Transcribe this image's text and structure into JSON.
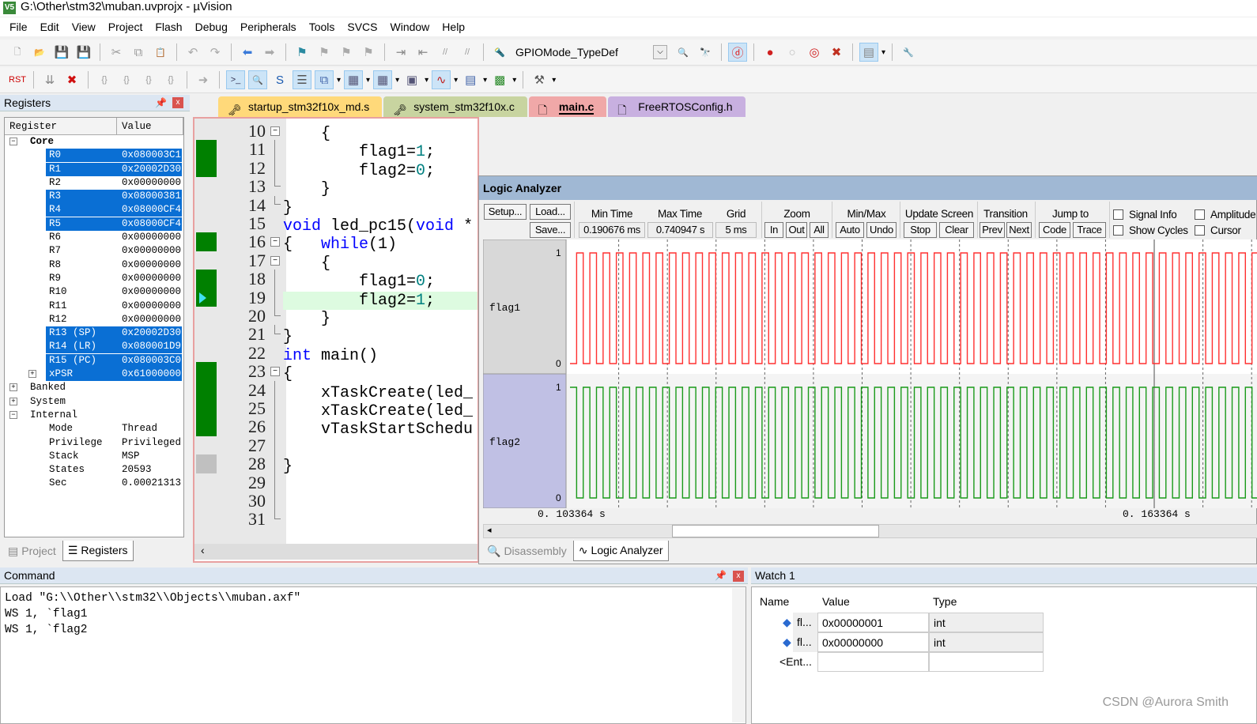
{
  "window": {
    "title": "G:\\Other\\stm32\\muban.uvprojx - µVision",
    "app_icon": "V5"
  },
  "menu": [
    "File",
    "Edit",
    "View",
    "Project",
    "Flash",
    "Debug",
    "Peripherals",
    "Tools",
    "SVCS",
    "Window",
    "Help"
  ],
  "toolbar1": {
    "icons_a": [
      "new-file-icon",
      "open-folder-icon",
      "save-icon",
      "save-all-icon",
      "|",
      "cut-icon",
      "copy-icon",
      "paste-icon",
      "|",
      "undo-icon",
      "redo-icon",
      "|",
      "nav-back-icon",
      "nav-forward-icon",
      "|",
      "bookmark-icon",
      "prev-bookmark-icon",
      "next-bookmark-icon",
      "clear-bookmarks-icon",
      "|",
      "indent-icon",
      "unindent-icon",
      "comment-icon",
      "uncomment-icon",
      "|",
      "find-in-files-icon"
    ],
    "combo_value": "GPIOMode_TypeDef",
    "icons_b": [
      "find-icon",
      "incremental-find-icon",
      "|",
      "debug-session-icon",
      "|",
      "breakpoint-icon",
      "disable-breakpoint-icon",
      "disable-all-breakpoints-icon",
      "kill-all-breakpoints-icon",
      "|",
      "window-layout-icon",
      "|",
      "configure-icon"
    ]
  },
  "toolbar2": {
    "icons": [
      "reset-icon",
      "|",
      "run-icon",
      "stop-icon",
      "|",
      "step-icon",
      "step-over-icon",
      "step-out-icon",
      "run-to-cursor-icon",
      "|",
      "show-next-statement-icon",
      "|",
      "command-window-icon",
      "disassembly-window-icon",
      "symbols-window-icon",
      "registers-window-icon",
      "call-stack-icon",
      "watch-window-icon",
      "memory-window-icon",
      "serial-window-icon",
      "analysis-window-icon",
      "trace-window-icon",
      "system-viewer-icon",
      "|",
      "toolbox-icon"
    ],
    "active": [
      "command-window-icon",
      "disassembly-window-icon",
      "registers-window-icon",
      "call-stack-icon",
      "watch-window-icon",
      "memory-window-icon",
      "analysis-window-icon",
      "debug-session-icon",
      "window-layout-icon"
    ]
  },
  "registers": {
    "title": "Registers",
    "col_register": "Register",
    "col_value": "Value",
    "rows": [
      {
        "name": "Core",
        "value": "",
        "level": 0,
        "expander": "-",
        "bold": true
      },
      {
        "name": "R0",
        "value": "0x080003C1",
        "level": 1,
        "sel": true
      },
      {
        "name": "R1",
        "value": "0x20002D30",
        "level": 1,
        "sel": true
      },
      {
        "name": "R2",
        "value": "0x00000000",
        "level": 1
      },
      {
        "name": "R3",
        "value": "0x08000381",
        "level": 1,
        "sel": true
      },
      {
        "name": "R4",
        "value": "0x08000CF4",
        "level": 1,
        "sel": true
      },
      {
        "name": "R5",
        "value": "0x08000CF4",
        "level": 1,
        "sel": true
      },
      {
        "name": "R6",
        "value": "0x00000000",
        "level": 1
      },
      {
        "name": "R7",
        "value": "0x00000000",
        "level": 1
      },
      {
        "name": "R8",
        "value": "0x00000000",
        "level": 1
      },
      {
        "name": "R9",
        "value": "0x00000000",
        "level": 1
      },
      {
        "name": "R10",
        "value": "0x00000000",
        "level": 1
      },
      {
        "name": "R11",
        "value": "0x00000000",
        "level": 1
      },
      {
        "name": "R12",
        "value": "0x00000000",
        "level": 1
      },
      {
        "name": "R13 (SP)",
        "value": "0x20002D30",
        "level": 1,
        "sel": true
      },
      {
        "name": "R14 (LR)",
        "value": "0x080001D9",
        "level": 1,
        "sel": true
      },
      {
        "name": "R15 (PC)",
        "value": "0x080003C0",
        "level": 1,
        "sel": true
      },
      {
        "name": "xPSR",
        "value": "0x61000000",
        "level": 1,
        "sel": true,
        "expander": "+"
      },
      {
        "name": "Banked",
        "value": "",
        "level": 0,
        "expander": "+"
      },
      {
        "name": "System",
        "value": "",
        "level": 0,
        "expander": "+"
      },
      {
        "name": "Internal",
        "value": "",
        "level": 0,
        "expander": "-"
      },
      {
        "name": "Mode",
        "value": "Thread",
        "level": 1
      },
      {
        "name": "Privilege",
        "value": "Privileged",
        "level": 1
      },
      {
        "name": "Stack",
        "value": "MSP",
        "level": 1
      },
      {
        "name": "States",
        "value": "20593",
        "level": 1
      },
      {
        "name": "Sec",
        "value": "0.00021313",
        "level": 1
      }
    ],
    "tabs": [
      {
        "label": "Project",
        "active": false
      },
      {
        "label": "Registers",
        "active": true
      }
    ]
  },
  "editor": {
    "tabs": [
      {
        "label": "startup_stm32f10x_md.s",
        "color": "#ffd97a",
        "icon": "key-file-icon"
      },
      {
        "label": "system_stm32f10x.c",
        "color": "#c8d4a0",
        "icon": "key-file-icon"
      },
      {
        "label": "main.c",
        "color": "#f0a8a8",
        "icon": "file-icon",
        "active": true
      },
      {
        "label": "FreeRTOSConfig.h",
        "color": "#c8b0e0",
        "icon": "file-icon"
      }
    ],
    "lines": [
      {
        "n": "10",
        "fold": "box",
        "code": [
          [
            "",
            "    {"
          ]
        ]
      },
      {
        "n": "11",
        "fold": "line",
        "mark": true,
        "code": [
          [
            "",
            "        flag1="
          ],
          [
            "num",
            "1"
          ],
          [
            "",
            ";"
          ]
        ]
      },
      {
        "n": "12",
        "fold": "line",
        "mark": true,
        "code": [
          [
            "",
            "        flag2="
          ],
          [
            "num",
            "0"
          ],
          [
            "",
            ";"
          ]
        ]
      },
      {
        "n": "13",
        "fold": "tee",
        "code": [
          [
            "",
            "    }"
          ]
        ]
      },
      {
        "n": "14",
        "fold": "end",
        "code": [
          [
            "",
            "}"
          ]
        ]
      },
      {
        "n": "15",
        "fold": "",
        "code": [
          [
            "kw",
            "void"
          ],
          [
            "",
            " led_pc15("
          ],
          [
            "kw",
            "void"
          ],
          [
            "",
            " *"
          ]
        ]
      },
      {
        "n": "16",
        "fold": "box",
        "mark": true,
        "code": [
          [
            "",
            "{   "
          ],
          [
            "kw",
            "while"
          ],
          [
            "",
            "(1)"
          ]
        ]
      },
      {
        "n": "17",
        "fold": "box",
        "code": [
          [
            "",
            "    {"
          ]
        ]
      },
      {
        "n": "18",
        "fold": "line",
        "mark": true,
        "code": [
          [
            "",
            "        flag1="
          ],
          [
            "num",
            "0"
          ],
          [
            "",
            ";"
          ]
        ]
      },
      {
        "n": "19",
        "fold": "line",
        "mark": true,
        "current": true,
        "code": [
          [
            "",
            "        flag2="
          ],
          [
            "num",
            "1"
          ],
          [
            "",
            ";"
          ]
        ]
      },
      {
        "n": "20",
        "fold": "tee",
        "code": [
          [
            "",
            "    }"
          ]
        ]
      },
      {
        "n": "21",
        "fold": "end",
        "code": [
          [
            "",
            "}"
          ]
        ]
      },
      {
        "n": "22",
        "fold": "",
        "code": [
          [
            "kw",
            "int"
          ],
          [
            "",
            " main()"
          ]
        ]
      },
      {
        "n": "23",
        "fold": "box",
        "mark": true,
        "code": [
          [
            "",
            "{"
          ]
        ]
      },
      {
        "n": "24",
        "fold": "line",
        "mark": true,
        "code": [
          [
            "",
            "    xTaskCreate(led_"
          ]
        ]
      },
      {
        "n": "25",
        "fold": "line",
        "mark": true,
        "code": [
          [
            "",
            "    xTaskCreate(led_"
          ]
        ]
      },
      {
        "n": "26",
        "fold": "line",
        "mark": true,
        "code": [
          [
            "",
            "    vTaskStartSchedu"
          ]
        ]
      },
      {
        "n": "27",
        "fold": "line",
        "code": []
      },
      {
        "n": "28",
        "fold": "line",
        "graymark": true,
        "code": [
          [
            "",
            "}"
          ]
        ]
      },
      {
        "n": "29",
        "fold": "line",
        "code": []
      },
      {
        "n": "30",
        "fold": "line",
        "code": []
      },
      {
        "n": "31",
        "fold": "end",
        "code": []
      }
    ]
  },
  "logic_analyzer": {
    "title": "Logic Analyzer",
    "buttons": {
      "setup": "Setup...",
      "load": "Load...",
      "save": "Save...",
      "zoom_in": "In",
      "zoom_out": "Out",
      "zoom_all": "All",
      "auto": "Auto",
      "undo": "Undo",
      "stop": "Stop",
      "clear": "Clear",
      "prev": "Prev",
      "next": "Next",
      "code": "Code",
      "trace": "Trace"
    },
    "labels": {
      "min_time": "Min Time",
      "max_time": "Max Time",
      "grid": "Grid",
      "zoom": "Zoom",
      "minmax": "Min/Max",
      "update_screen": "Update Screen",
      "transition": "Transition",
      "jump_to": "Jump to"
    },
    "values": {
      "min_time": "0.190676 ms",
      "max_time": "0.740947 s",
      "grid": "5 ms"
    },
    "checkboxes": [
      {
        "label": "Signal Info",
        "checked": false
      },
      {
        "label": "Show Cycles",
        "checked": false
      },
      {
        "label": "Amplitude",
        "checked": false
      },
      {
        "label": "Cursor",
        "checked": false
      }
    ],
    "time_left": "0. 103364  s",
    "time_cursor": "0. 163364  s",
    "tabs": [
      {
        "label": "Disassembly",
        "active": false
      },
      {
        "label": "Logic Analyzer",
        "active": true
      }
    ]
  },
  "chart_data": {
    "type": "line",
    "step": true,
    "x_unit": "s",
    "xlim": [
      0.103364,
      0.174
    ],
    "cursor_time": 0.163364,
    "grid_ms": 5,
    "grid": true,
    "series": [
      {
        "name": "flag1",
        "color": "#ff3030",
        "ylim": [
          0,
          1
        ],
        "y_ticks": [
          "1",
          "0"
        ],
        "period_ms": 1.36,
        "initial": 0
      },
      {
        "name": "flag2",
        "color": "#1a9a1a",
        "ylim": [
          0,
          1
        ],
        "y_ticks": [
          "1",
          "0"
        ],
        "period_ms": 1.36,
        "initial": 1
      }
    ]
  },
  "command": {
    "title": "Command",
    "lines": [
      "Load \"G:\\\\Other\\\\stm32\\\\Objects\\\\muban.axf\"",
      "WS 1, `flag1",
      "WS 1, `flag2"
    ]
  },
  "watch": {
    "title": "Watch 1",
    "col_name": "Name",
    "col_value": "Value",
    "col_type": "Type",
    "rows": [
      {
        "name": "fl...",
        "value": "0x00000001",
        "type": "int"
      },
      {
        "name": "fl...",
        "value": "0x00000000",
        "type": "int"
      }
    ],
    "enter_placeholder": "<Ent..."
  },
  "watermark": "CSDN @Aurora Smith"
}
